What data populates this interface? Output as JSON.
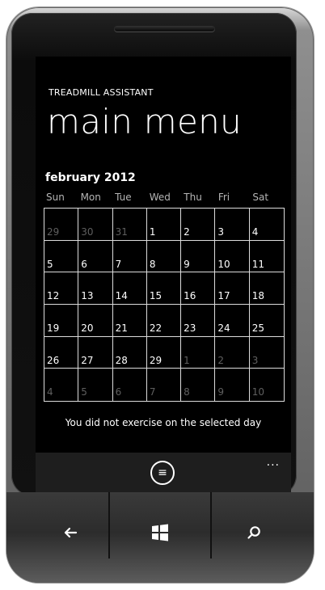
{
  "app": {
    "title": "TREADMILL ASSISTANT",
    "page_title": "main menu"
  },
  "calendar": {
    "month_label": "february 2012",
    "weekdays": [
      "Sun",
      "Mon",
      "Tue",
      "Wed",
      "Thu",
      "Fri",
      "Sat"
    ],
    "cells": [
      {
        "day": "29",
        "muted": true
      },
      {
        "day": "30",
        "muted": true
      },
      {
        "day": "31",
        "muted": true
      },
      {
        "day": "1",
        "muted": false
      },
      {
        "day": "2",
        "muted": false
      },
      {
        "day": "3",
        "muted": false
      },
      {
        "day": "4",
        "muted": false
      },
      {
        "day": "5",
        "muted": false
      },
      {
        "day": "6",
        "muted": false
      },
      {
        "day": "7",
        "muted": false
      },
      {
        "day": "8",
        "muted": false
      },
      {
        "day": "9",
        "muted": false
      },
      {
        "day": "10",
        "muted": false
      },
      {
        "day": "11",
        "muted": false
      },
      {
        "day": "12",
        "muted": false
      },
      {
        "day": "13",
        "muted": false
      },
      {
        "day": "14",
        "muted": false
      },
      {
        "day": "15",
        "muted": false
      },
      {
        "day": "16",
        "muted": false
      },
      {
        "day": "17",
        "muted": false
      },
      {
        "day": "18",
        "muted": false
      },
      {
        "day": "19",
        "muted": false
      },
      {
        "day": "20",
        "muted": false
      },
      {
        "day": "21",
        "muted": false
      },
      {
        "day": "22",
        "muted": false
      },
      {
        "day": "23",
        "muted": false
      },
      {
        "day": "24",
        "muted": false
      },
      {
        "day": "25",
        "muted": false
      },
      {
        "day": "26",
        "muted": false
      },
      {
        "day": "27",
        "muted": false
      },
      {
        "day": "28",
        "muted": false
      },
      {
        "day": "29",
        "muted": false
      },
      {
        "day": "1",
        "muted": true
      },
      {
        "day": "2",
        "muted": true
      },
      {
        "day": "3",
        "muted": true
      },
      {
        "day": "4",
        "muted": true
      },
      {
        "day": "5",
        "muted": true
      },
      {
        "day": "6",
        "muted": true
      },
      {
        "day": "7",
        "muted": true
      },
      {
        "day": "8",
        "muted": true
      },
      {
        "day": "9",
        "muted": true
      },
      {
        "day": "10",
        "muted": true
      }
    ]
  },
  "status": {
    "message": "You did not exercise on the selected day"
  },
  "app_bar": {
    "more": "...",
    "list_icon": "≡"
  },
  "icons": {
    "back": "back-icon",
    "windows": "windows-icon",
    "search": "search-icon",
    "list": "list-icon",
    "more": "more-icon"
  }
}
